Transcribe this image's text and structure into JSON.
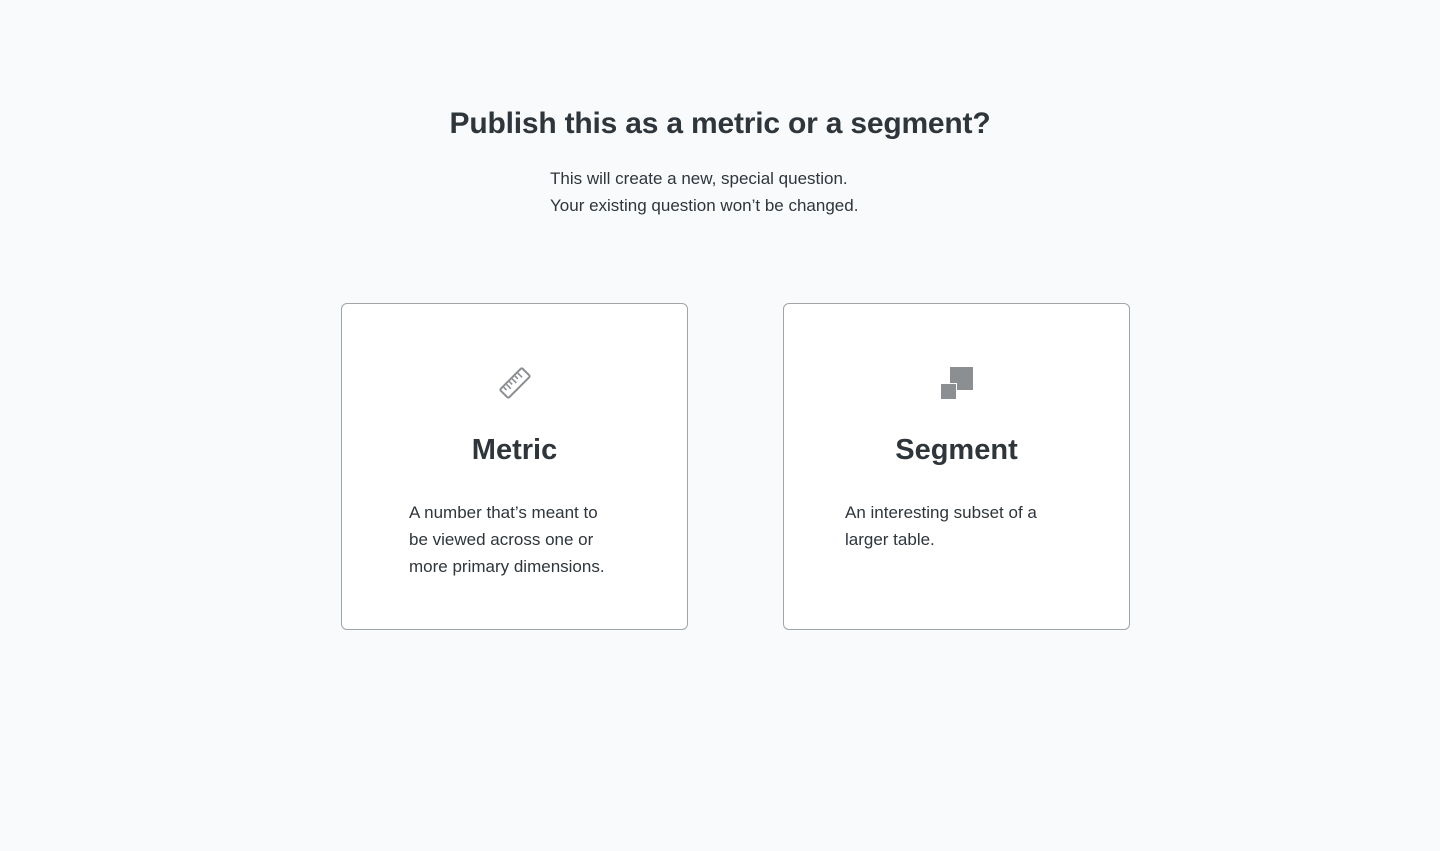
{
  "header": {
    "title": "Publish this as a metric or a segment?",
    "subtitle_lines": [
      "This will create a new, special question.",
      "Your existing question won’t be changed."
    ]
  },
  "options": [
    {
      "icon": "ruler-icon",
      "title": "Metric",
      "description_lines": [
        "A number that’s meant to",
        "be viewed across one or",
        "more primary dimensions."
      ]
    },
    {
      "icon": "segment-icon",
      "title": "Segment",
      "description_lines": [
        "An interesting subset of a",
        "larger table."
      ]
    }
  ],
  "colors": {
    "background": "#f9fafb",
    "text": "#2e353b",
    "card_border": "#a1a5a9",
    "icon": "#8c8f92"
  }
}
